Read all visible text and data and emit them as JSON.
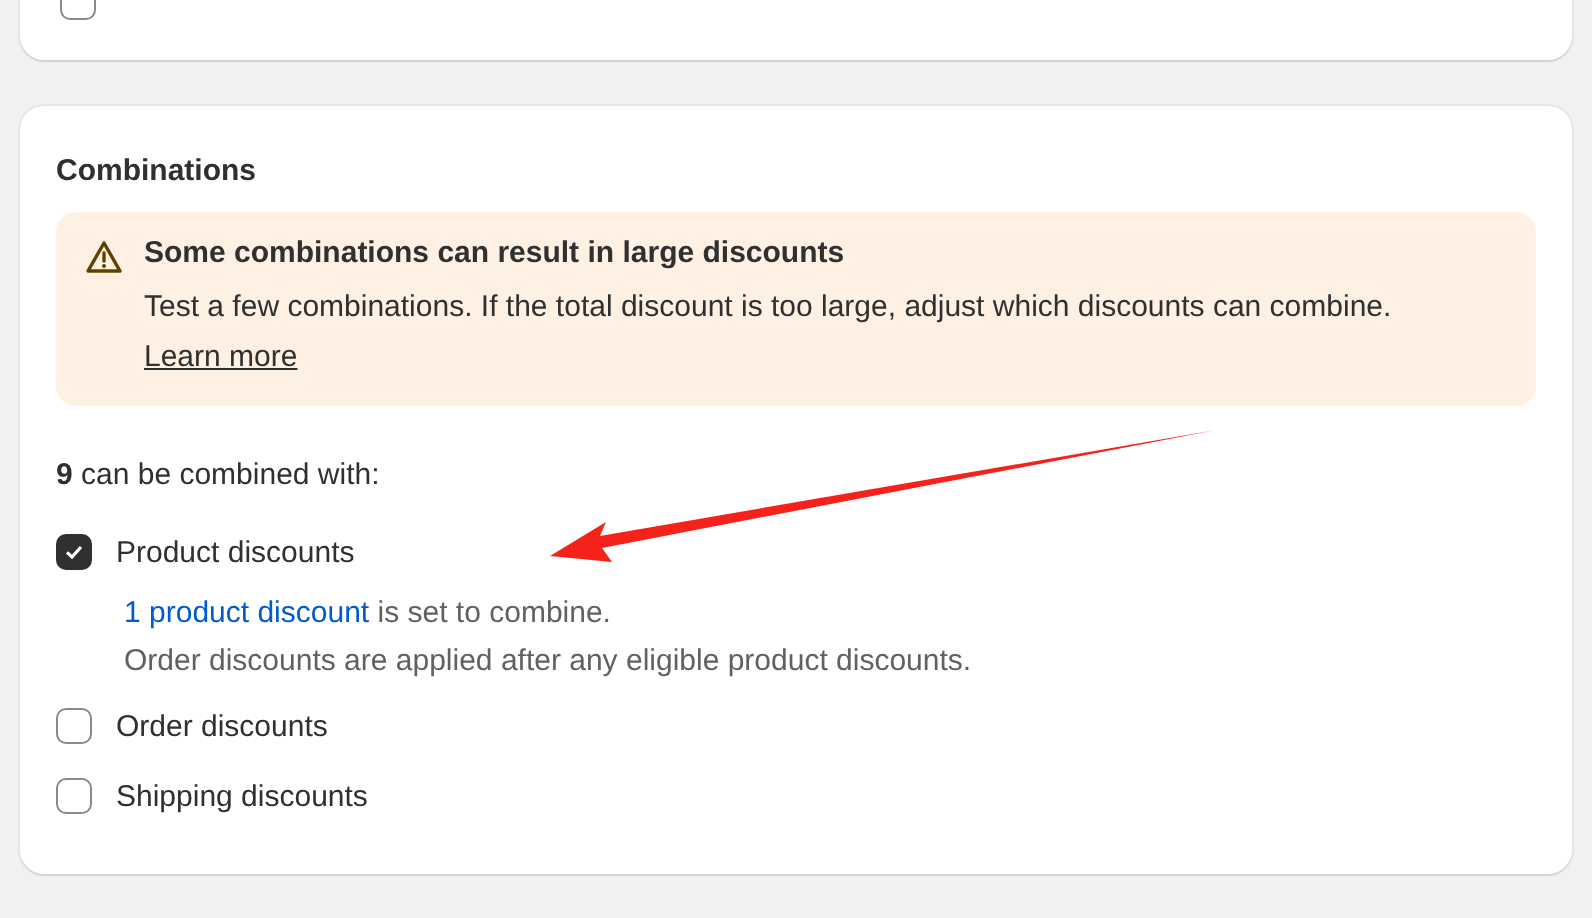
{
  "top_card": {
    "checkbox": {
      "checked": false
    }
  },
  "combinations": {
    "title": "Combinations",
    "banner": {
      "title": "Some combinations can result in large discounts",
      "text": "Test a few combinations. If the total discount is too large, adjust which discounts can combine.",
      "link": "Learn more"
    },
    "count_text": "**9** can be combined with:",
    "options": [
      {
        "label": "Product discounts",
        "checked": true,
        "link": "1 product discount",
        "link_suffix": "is set to combine.",
        "note": "Order discounts are applied after any eligible product discounts."
      },
      {
        "label": "Order discounts",
        "checked": false
      },
      {
        "label": "Shipping discounts",
        "checked": false
      }
    ]
  }
}
